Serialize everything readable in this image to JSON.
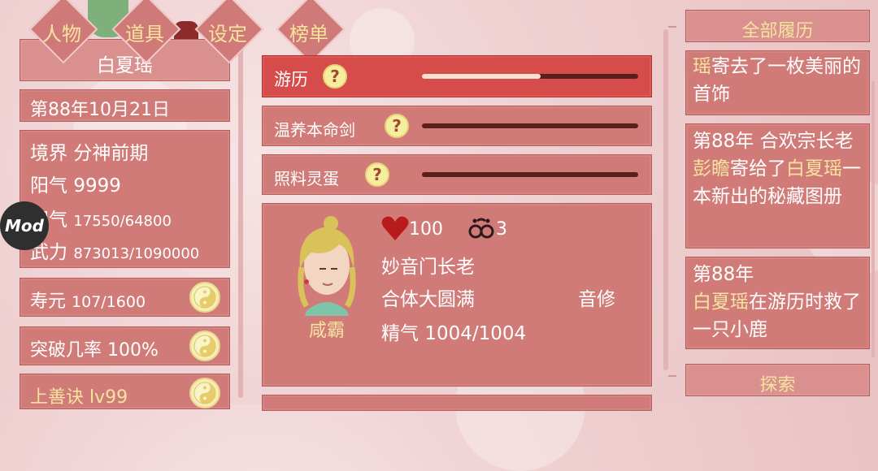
{
  "nav": {
    "character": "人物",
    "items": "道具",
    "settings": "设定",
    "ranking": "榜单"
  },
  "player": {
    "name": "白夏瑶",
    "date": "第88年10月21日",
    "realm_label": "境界",
    "realm_value": "分神前期",
    "yang_label": "阳气",
    "yang_value": "9999",
    "yin_label": "阴气",
    "yin_value": "17550/64800",
    "force_label": "武力",
    "force_value": "873013/1090000",
    "lifespan_label": "寿元",
    "lifespan_value": "107/1600",
    "breakthrough_label": "突破几率",
    "breakthrough_value": "100%",
    "skill": "上善诀 lv99"
  },
  "mod_badge": "Mod",
  "activities": [
    {
      "label": "游历",
      "progress": 0.55
    },
    {
      "label": "温养本命剑",
      "progress": 0
    },
    {
      "label": "照料灵蛋",
      "progress": 0
    }
  ],
  "npc": {
    "name": "咸霸",
    "hearts": "100",
    "bonds": "3",
    "title": "妙音门长老",
    "realm": "合体大圆满",
    "path": "音修",
    "essence_label": "精气",
    "essence_value": "1004/1004"
  },
  "history": {
    "header": "全部履历",
    "entries": [
      {
        "p1": "瑶",
        "p2": "寄去了一枚美丽的首饰"
      },
      {
        "p1": "第88年 合欢宗长老",
        "name1": "彭瞻",
        "p2": "寄给了",
        "name2": "白夏瑶",
        "p3": "一本新出的秘藏图册"
      },
      {
        "p1": "第88年",
        "name1": "白夏瑶",
        "p2": "在游历时救了一只小鹿"
      }
    ],
    "explore": "探索"
  },
  "colors": {
    "panel": "#d17b79",
    "highlight": "#f6e39f",
    "active_row": "#d64c4a"
  }
}
